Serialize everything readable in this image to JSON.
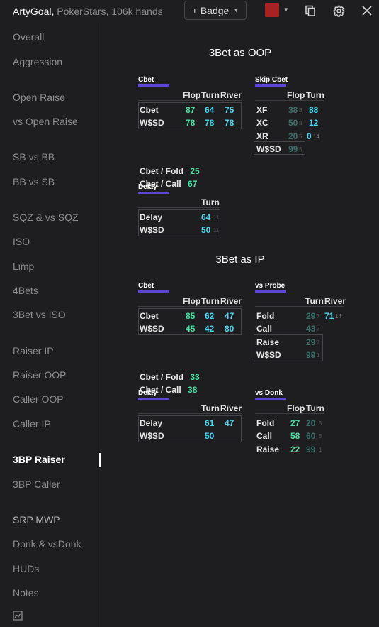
{
  "title": {
    "app": "ArtyGoal",
    "separator": ",",
    "subtitle": "PokerStars, 106k hands"
  },
  "toolbar": {
    "badge_label": "+ Badge",
    "swatch_color": "#a82123",
    "icons": [
      "copy-icon",
      "gear-icon",
      "close-icon"
    ]
  },
  "sidebar": {
    "items": [
      "Overall",
      "Aggression",
      "Open Raise",
      "vs Open Raise",
      "SB vs BB",
      "BB vs SB",
      "SQZ & vs SQZ",
      "ISO",
      "Limp",
      "4Bets",
      "3Bet vs ISO",
      "Raiser IP",
      "Raiser OOP",
      "Caller OOP",
      "Caller IP",
      "3BP Raiser",
      "3BP Caller",
      "SRP MWP",
      "Donk & vsDonk",
      "HUDs",
      "Notes"
    ],
    "active": "3BP Raiser"
  },
  "oop": {
    "heading": "3Bet as OOP",
    "cbet": {
      "title": "Cbet",
      "headers": [
        "Flop",
        "Turn",
        "River"
      ],
      "rows": [
        {
          "label": "Cbet",
          "values": [
            "87",
            "64",
            "75"
          ]
        },
        {
          "label": "W$SD",
          "values": [
            "78",
            "78",
            "78"
          ]
        }
      ],
      "extras": [
        {
          "label": "Cbet / Fold",
          "value": "25"
        },
        {
          "label": "Cbet / Call",
          "value": "67"
        }
      ]
    },
    "skip_cbet": {
      "title": "Skip Cbet",
      "headers": [
        "Flop",
        "Turn"
      ],
      "rows": [
        {
          "label": "XF",
          "flop": "38",
          "flop_n": "8",
          "turn": "88",
          "turn_n": ""
        },
        {
          "label": "XC",
          "flop": "50",
          "flop_n": "8",
          "turn": "12",
          "turn_n": ""
        },
        {
          "label": "XR",
          "flop": "20",
          "flop_n": "5",
          "turn": "0",
          "turn_n": "14"
        },
        {
          "label": "W$SD",
          "flop": "99",
          "flop_n": "5",
          "turn": "",
          "turn_n": ""
        }
      ]
    },
    "delay": {
      "title": "Delay",
      "headers": [
        "Turn"
      ],
      "rows": [
        {
          "label": "Delay",
          "value": "64",
          "n": "11"
        },
        {
          "label": "W$SD",
          "value": "50",
          "n": "11"
        }
      ]
    }
  },
  "ip": {
    "heading": "3Bet as IP",
    "cbet": {
      "title": "Cbet",
      "headers": [
        "Flop",
        "Turn",
        "River"
      ],
      "rows": [
        {
          "label": "Cbet",
          "values": [
            "85",
            "62",
            "47"
          ]
        },
        {
          "label": "W$SD",
          "values": [
            "45",
            "42",
            "80"
          ]
        }
      ],
      "extras": [
        {
          "label": "Cbet / Fold",
          "value": "33"
        },
        {
          "label": "Cbet / Call",
          "value": "38"
        }
      ]
    },
    "vs_probe": {
      "title": "vs Probe",
      "headers": [
        "Turn",
        "River"
      ],
      "rows": [
        {
          "label": "Fold",
          "turn": "29",
          "turn_n": "7",
          "river": "71",
          "river_n": "14"
        },
        {
          "label": "Call",
          "turn": "43",
          "turn_n": "7",
          "river": "",
          "river_n": ""
        },
        {
          "label": "Raise",
          "turn": "29",
          "turn_n": "7",
          "river": "",
          "river_n": ""
        },
        {
          "label": "W$SD",
          "turn": "99",
          "turn_n": "1",
          "river": "",
          "river_n": ""
        }
      ]
    },
    "delay": {
      "title": "Delay",
      "headers": [
        "Turn",
        "River"
      ],
      "rows": [
        {
          "label": "Delay",
          "values": [
            "61",
            "47"
          ]
        },
        {
          "label": "W$SD",
          "values": [
            "50",
            ""
          ]
        }
      ]
    },
    "vs_donk": {
      "title": "vs Donk",
      "headers": [
        "Flop",
        "Turn"
      ],
      "rows": [
        {
          "label": "Fold",
          "flop": "27",
          "turn": "20",
          "turn_n": "5"
        },
        {
          "label": "Call",
          "flop": "58",
          "turn": "60",
          "turn_n": "5"
        },
        {
          "label": "Raise",
          "flop": "22",
          "turn": "99",
          "turn_n": "1"
        }
      ]
    }
  }
}
